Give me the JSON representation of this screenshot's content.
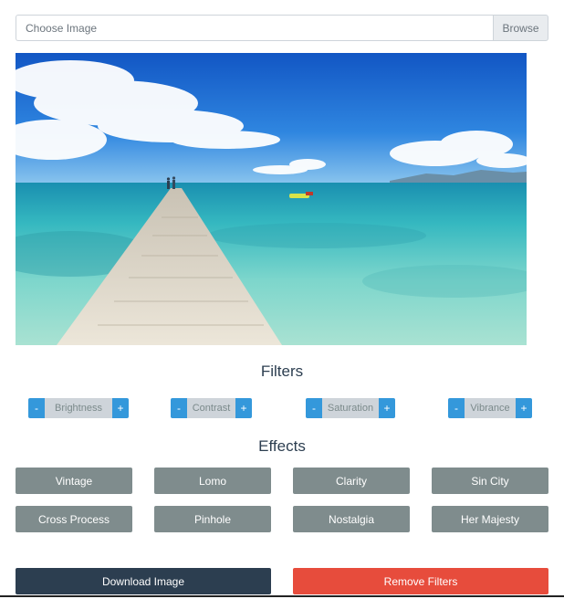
{
  "file_input": {
    "placeholder": "Choose Image",
    "browse_label": "Browse"
  },
  "photo": {
    "subject": "wooden pier over turquoise sea",
    "sky_color": "#1f6fd6",
    "sea_color": "#5cc9c4"
  },
  "filters": {
    "title": "Filters",
    "minus_label": "-",
    "plus_label": "+",
    "items": [
      {
        "label": "Brightness"
      },
      {
        "label": "Contrast"
      },
      {
        "label": "Saturation"
      },
      {
        "label": "Vibrance"
      }
    ]
  },
  "effects": {
    "title": "Effects",
    "items": [
      {
        "label": "Vintage"
      },
      {
        "label": "Lomo"
      },
      {
        "label": "Clarity"
      },
      {
        "label": "Sin City"
      },
      {
        "label": "Cross Process"
      },
      {
        "label": "Pinhole"
      },
      {
        "label": "Nostalgia"
      },
      {
        "label": "Her Majesty"
      }
    ]
  },
  "actions": {
    "download_label": "Download Image",
    "remove_label": "Remove Filters"
  },
  "colors": {
    "primary": "#3498db",
    "effect": "#7f8c8d",
    "dark": "#2c3e50",
    "danger": "#e74c3c"
  }
}
